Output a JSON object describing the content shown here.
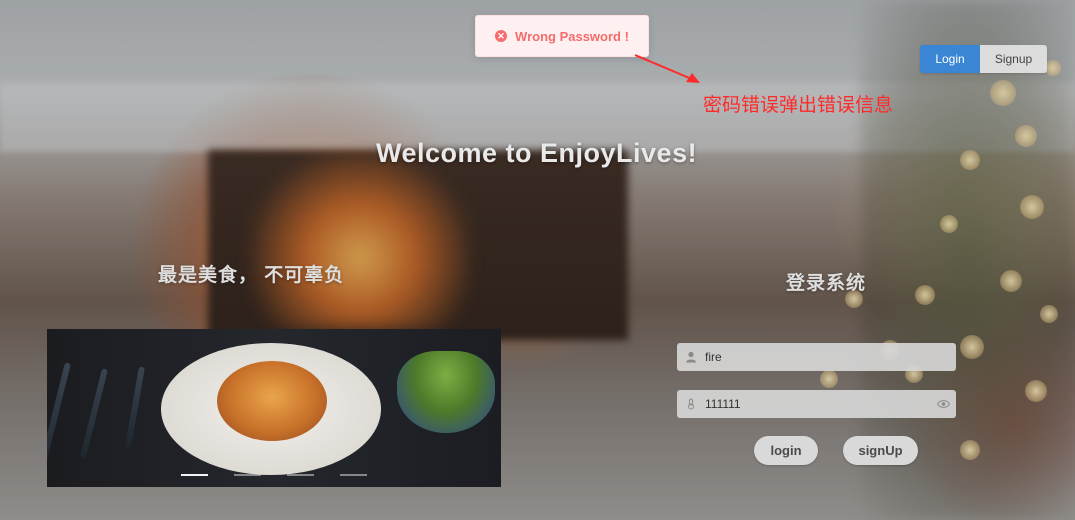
{
  "toast": {
    "message": "Wrong Password !",
    "icon": "error-circle-icon",
    "color": "#f56c6c"
  },
  "annotation": {
    "text": "密码错误弹出错误信息",
    "color": "#ff2a2a"
  },
  "auth_switch": {
    "login_label": "Login",
    "signup_label": "Signup",
    "active": "Login",
    "accent": "#3a86d4"
  },
  "hero": {
    "welcome": "Welcome to EnjoyLives!",
    "slogan": "最是美食， 不可辜负"
  },
  "carousel": {
    "indicator_count": 4,
    "active_index": 0
  },
  "login_form": {
    "title": "登录系统",
    "username": {
      "value": "fire",
      "icon": "user-icon"
    },
    "password": {
      "value": "111111",
      "icon": "lock-icon",
      "toggle_icon": "eye-icon"
    },
    "login_button": "login",
    "signup_button": "signUp"
  }
}
